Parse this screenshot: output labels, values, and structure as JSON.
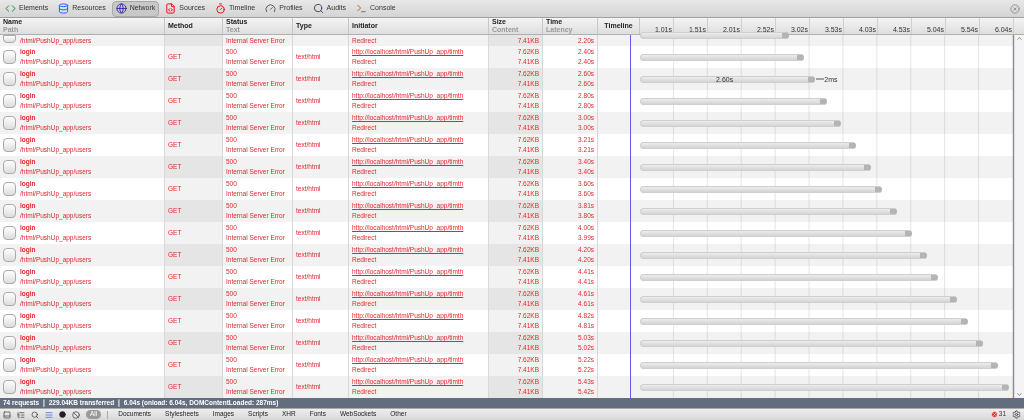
{
  "tabs": [
    {
      "label": "Elements",
      "selected": false
    },
    {
      "label": "Resources",
      "selected": false
    },
    {
      "label": "Network",
      "selected": true
    },
    {
      "label": "Sources",
      "selected": false
    },
    {
      "label": "Timeline",
      "selected": false
    },
    {
      "label": "Profiles",
      "selected": false
    },
    {
      "label": "Audits",
      "selected": false
    },
    {
      "label": "Console",
      "selected": false
    }
  ],
  "columns": [
    {
      "title": "Name",
      "subtitle": "Path"
    },
    {
      "title": "Method"
    },
    {
      "title": "Status",
      "subtitle": "Text"
    },
    {
      "title": "Type"
    },
    {
      "title": "Initiator"
    },
    {
      "title": "Size",
      "subtitle": "Content"
    },
    {
      "title": "Time",
      "subtitle": "Latency"
    },
    {
      "title": "Timeline"
    }
  ],
  "timeline_ticks": [
    "1.01s",
    "1.51s",
    "2.01s",
    "2.52s",
    "3.02s",
    "3.53s",
    "4.03s",
    "4.53s",
    "5.04s",
    "5.54s",
    "6.04s"
  ],
  "rows": [
    {
      "kind": "clipped",
      "path": "/html/PushUp_app/users",
      "status_text": "Internal Server Error",
      "initiator_detail": "Redirect",
      "content": "7.41KB",
      "latency": "2.20s",
      "level": 0.4
    },
    {
      "kind": "full",
      "name": "login",
      "path": "/html/PushUp_app/users",
      "method": "GET",
      "status": "500",
      "status_text": "Internal Server Error",
      "type": "text/html",
      "initiator": "http://localhost/html/PushUp_app/timth",
      "initiator_detail": "Redirect",
      "size": "7.62KB",
      "content": "7.41KB",
      "time": "2.40s",
      "latency": "2.40s",
      "level": 0.44
    },
    {
      "kind": "full",
      "name": "login",
      "path": "/html/PushUp_app/users",
      "method": "GET",
      "status": "500",
      "status_text": "Internal Server Error",
      "type": "text/html",
      "initiator": "http://localhost/html/PushUp_app/timth",
      "initiator_detail": "Redirect",
      "size": "7.62KB",
      "content": "7.41KB",
      "time": "2.60s",
      "latency": "2.60s",
      "level": 0.47,
      "bar_label": "2.60s",
      "after_label": "2ms"
    },
    {
      "kind": "full",
      "name": "login",
      "path": "/html/PushUp_app/users",
      "method": "GET",
      "status": "500",
      "status_text": "Internal Server Error",
      "type": "text/html",
      "initiator": "http://localhost/html/PushUp_app/timth",
      "initiator_detail": "Redirect",
      "size": "7.62KB",
      "content": "7.41KB",
      "time": "2.80s",
      "latency": "2.80s",
      "level": 0.5
    },
    {
      "kind": "full",
      "name": "login",
      "path": "/html/PushUp_app/users",
      "method": "GET",
      "status": "500",
      "status_text": "Internal Server Error",
      "type": "text/html",
      "initiator": "http://localhost/html/PushUp_app/timth",
      "initiator_detail": "Redirect",
      "size": "7.62KB",
      "content": "7.41KB",
      "time": "3.00s",
      "latency": "3.00s",
      "level": 0.54
    },
    {
      "kind": "full",
      "name": "login",
      "path": "/html/PushUp_app/users",
      "method": "GET",
      "status": "500",
      "status_text": "Internal Server Error",
      "type": "text/html",
      "initiator": "http://localhost/html/PushUp_app/timth",
      "initiator_detail": "Redirect",
      "size": "7.62KB",
      "content": "7.41KB",
      "time": "3.21s",
      "latency": "3.21s",
      "level": 0.58
    },
    {
      "kind": "full",
      "name": "login",
      "path": "/html/PushUp_app/users",
      "method": "GET",
      "status": "500",
      "status_text": "Internal Server Error",
      "type": "text/html",
      "initiator": "http://localhost/html/PushUp_app/timth",
      "initiator_detail": "Redirect",
      "size": "7.62KB",
      "content": "7.41KB",
      "time": "3.40s",
      "latency": "3.40s",
      "level": 0.62
    },
    {
      "kind": "full",
      "name": "login",
      "path": "/html/PushUp_app/users",
      "method": "GET",
      "status": "500",
      "status_text": "Internal Server Error",
      "type": "text/html",
      "initiator": "http://localhost/html/PushUp_app/timth",
      "initiator_detail": "Redirect",
      "size": "7.62KB",
      "content": "7.41KB",
      "time": "3.60s",
      "latency": "3.60s",
      "level": 0.65
    },
    {
      "kind": "full",
      "name": "login",
      "path": "/html/PushUp_app/users",
      "method": "GET",
      "status": "500",
      "status_text": "Internal Server Error",
      "type": "text/html",
      "initiator": "http://localhost/html/PushUp_app/timth",
      "initiator_detail": "Redirect",
      "size": "7.62KB",
      "content": "7.41KB",
      "time": "3.81s",
      "latency": "3.80s",
      "level": 0.69
    },
    {
      "kind": "full",
      "name": "login",
      "path": "/html/PushUp_app/users",
      "method": "GET",
      "status": "500",
      "status_text": "Internal Server Error",
      "type": "text/html",
      "initiator": "http://localhost/html/PushUp_app/timth",
      "initiator_detail": "Redirect",
      "size": "7.62KB",
      "content": "7.41KB",
      "time": "4.00s",
      "latency": "3.99s",
      "level": 0.73
    },
    {
      "kind": "full",
      "name": "login",
      "path": "/html/PushUp_app/users",
      "method": "GET",
      "status": "500",
      "status_text": "Internal Server Error",
      "type": "text/html",
      "initiator": "http://localhost/html/PushUp_app/timth",
      "initiator_detail": "Redirect",
      "size": "7.62KB",
      "content": "7.41KB",
      "time": "4.20s",
      "latency": "4.20s",
      "level": 0.77
    },
    {
      "kind": "full",
      "name": "login",
      "path": "/html/PushUp_app/users",
      "method": "GET",
      "status": "500",
      "status_text": "Internal Server Error",
      "type": "text/html",
      "initiator": "http://localhost/html/PushUp_app/timth",
      "initiator_detail": "Redirect",
      "size": "7.62KB",
      "content": "7.41KB",
      "time": "4.41s",
      "latency": "4.41s",
      "level": 0.8
    },
    {
      "kind": "full",
      "name": "login",
      "path": "/html/PushUp_app/users",
      "method": "GET",
      "status": "500",
      "status_text": "Internal Server Error",
      "type": "text/html",
      "initiator": "http://localhost/html/PushUp_app/timth",
      "initiator_detail": "Redirect",
      "size": "7.62KB",
      "content": "7.41KB",
      "time": "4.61s",
      "latency": "4.61s",
      "level": 0.85
    },
    {
      "kind": "full",
      "name": "login",
      "path": "/html/PushUp_app/users",
      "method": "GET",
      "status": "500",
      "status_text": "Internal Server Error",
      "type": "text/html",
      "initiator": "http://localhost/html/PushUp_app/timth",
      "initiator_detail": "Redirect",
      "size": "7.62KB",
      "content": "7.41KB",
      "time": "4.82s",
      "latency": "4.81s",
      "level": 0.88
    },
    {
      "kind": "full",
      "name": "login",
      "path": "/html/PushUp_app/users",
      "method": "GET",
      "status": "500",
      "status_text": "Internal Server Error",
      "type": "text/html",
      "initiator": "http://localhost/html/PushUp_app/timth",
      "initiator_detail": "Redirect",
      "size": "7.62KB",
      "content": "7.41KB",
      "time": "5.03s",
      "latency": "5.02s",
      "level": 0.92
    },
    {
      "kind": "full",
      "name": "login",
      "path": "/html/PushUp_app/users",
      "method": "GET",
      "status": "500",
      "status_text": "Internal Server Error",
      "type": "text/html",
      "initiator": "http://localhost/html/PushUp_app/timth",
      "initiator_detail": "Redirect",
      "size": "7.62KB",
      "content": "7.41KB",
      "time": "5.22s",
      "latency": "5.22s",
      "level": 0.96
    },
    {
      "kind": "full",
      "name": "login",
      "path": "/html/PushUp_app/users",
      "method": "GET",
      "status": "500",
      "status_text": "Internal Server Error",
      "type": "text/html",
      "initiator": "http://localhost/html/PushUp_app/timth",
      "initiator_detail": "Redirect",
      "size": "7.62KB",
      "content": "7.41KB",
      "time": "5.43s",
      "latency": "5.42s",
      "level": 0.99
    }
  ],
  "summary": "74 requests ❘ 229.04KB transferred ❘ 6.04s (onload: 6.04s, DOMContentLoaded: 287ms)",
  "filters": [
    {
      "label": "All",
      "selected": true
    },
    {
      "label": "Documents",
      "selected": false
    },
    {
      "label": "Stylesheets",
      "selected": false
    },
    {
      "label": "Images",
      "selected": false
    },
    {
      "label": "Scripts",
      "selected": false
    },
    {
      "label": "XHR",
      "selected": false
    },
    {
      "label": "Fonts",
      "selected": false
    },
    {
      "label": "WebSockets",
      "selected": false
    },
    {
      "label": "Other",
      "selected": false
    }
  ],
  "error_count": "31"
}
